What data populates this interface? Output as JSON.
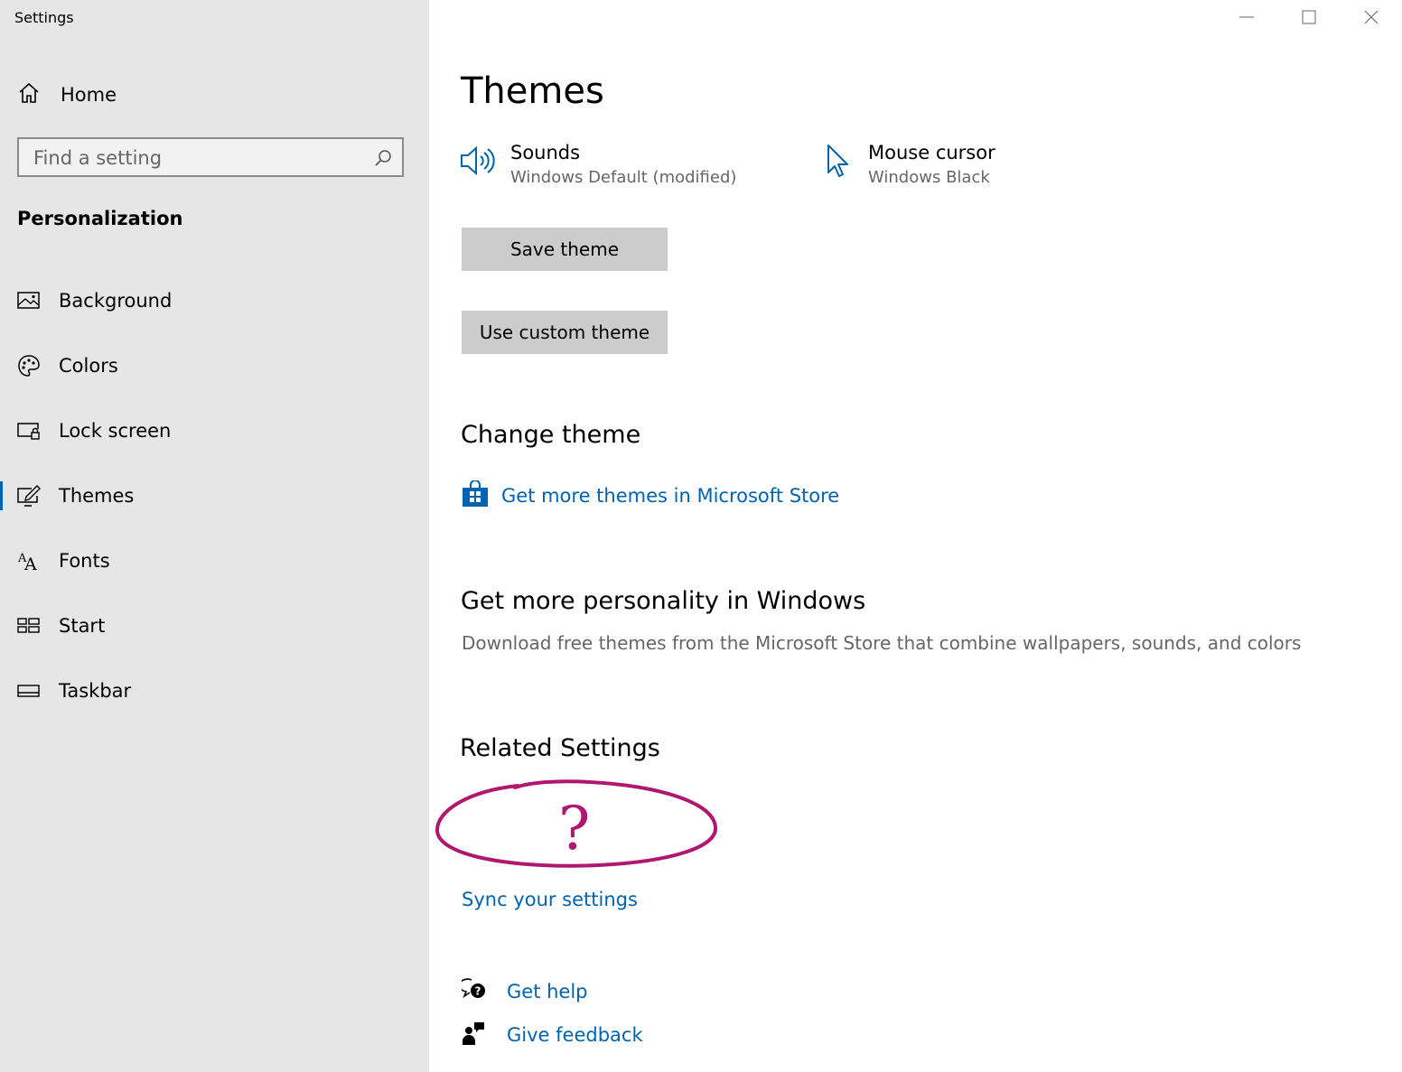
{
  "window": {
    "title": "Settings",
    "controls": [
      "minimize",
      "maximize",
      "close"
    ]
  },
  "sidebar": {
    "home": {
      "label": "Home",
      "icon": "home-icon"
    },
    "search": {
      "placeholder": "Find a setting",
      "value": "",
      "icon": "search-icon"
    },
    "section": "Personalization",
    "items": [
      {
        "label": "Background",
        "icon": "background-icon",
        "selected": false
      },
      {
        "label": "Colors",
        "icon": "palette-icon",
        "selected": false
      },
      {
        "label": "Lock screen",
        "icon": "lock-screen-icon",
        "selected": false
      },
      {
        "label": "Themes",
        "icon": "themes-icon",
        "selected": true
      },
      {
        "label": "Fonts",
        "icon": "fonts-icon",
        "selected": false
      },
      {
        "label": "Start",
        "icon": "start-icon",
        "selected": false
      },
      {
        "label": "Taskbar",
        "icon": "taskbar-icon",
        "selected": false
      }
    ]
  },
  "main": {
    "title": "Themes",
    "sounds": {
      "name": "Sounds",
      "value": "Windows Default (modified)",
      "icon": "speaker-icon"
    },
    "mouse": {
      "name": "Mouse cursor",
      "value": "Windows Black",
      "icon": "cursor-icon"
    },
    "save_theme": "Save theme",
    "use_custom_theme": "Use custom theme",
    "change_theme": {
      "heading": "Change theme",
      "store_link": "Get more themes in Microsoft Store",
      "icon": "store-icon"
    },
    "personality": {
      "heading": "Get more personality in Windows",
      "description": "Download free themes from the Microsoft Store that combine wallpapers, sounds, and colors"
    },
    "related": {
      "heading": "Related Settings",
      "annotation_text": "?",
      "sync": "Sync your settings"
    },
    "help": {
      "label": "Get help",
      "icon": "help-icon"
    },
    "feedback": {
      "label": "Give feedback",
      "icon": "feedback-icon"
    }
  },
  "colors": {
    "accent": "#0063b1",
    "sidebar_bg": "#e6e6e6",
    "button_bg": "#cccccc",
    "secondary_text": "#666666",
    "annotation": "#b0176e"
  }
}
